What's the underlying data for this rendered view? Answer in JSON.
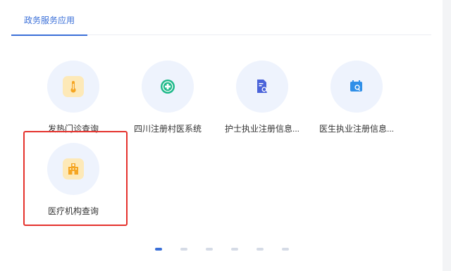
{
  "tabs": [
    {
      "label": "政务服务应用",
      "active": true
    }
  ],
  "apps": [
    {
      "label": "发热门诊查询",
      "icon": "thermometer-icon",
      "color": "#f5a623"
    },
    {
      "label": "四川注册村医系统",
      "icon": "medical-cross-icon",
      "color": "#1fb98a"
    },
    {
      "label": "护士执业注册信息...",
      "icon": "document-search-icon",
      "color": "#4a63d9"
    },
    {
      "label": "医生执业注册信息...",
      "icon": "calendar-search-icon",
      "color": "#2f8fe8"
    },
    {
      "label": "医疗机构查询",
      "icon": "hospital-building-icon",
      "color": "#f5a623"
    }
  ],
  "pagination": {
    "total": 6,
    "current": 1
  },
  "highlight_color": "#e5322d",
  "accent_color": "#3a6fd8"
}
